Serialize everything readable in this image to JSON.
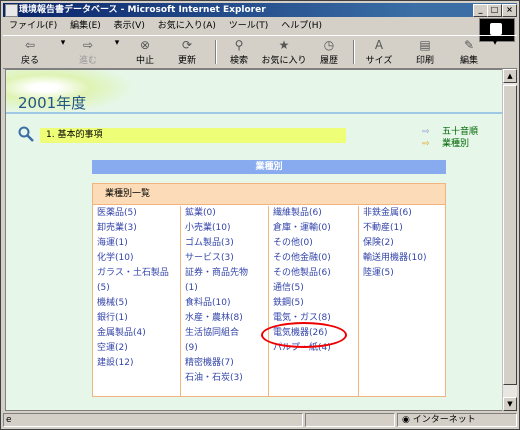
{
  "window": {
    "title": "環境報告書データベース - Microsoft Internet Explorer",
    "controls": [
      "_",
      "□",
      "×"
    ]
  },
  "menu": [
    "ファイル(F)",
    "編集(E)",
    "表示(V)",
    "お気に入り(A)",
    "ツール(T)",
    "ヘルプ(H)"
  ],
  "toolbar": {
    "back": "戻る",
    "forward": "進む",
    "stop": "中止",
    "refresh": "更新",
    "search": "検索",
    "favorites": "お気に入り",
    "history": "履歴",
    "size": "サイズ",
    "print": "印刷",
    "edit": "編集"
  },
  "page": {
    "year": "2001年度",
    "section": "1. 基本的事項",
    "links": [
      "五十音順",
      "業種別"
    ],
    "industry_header": "業種別",
    "industry_list_title": "業種別一覧",
    "columns": [
      [
        "医薬品(5)",
        "卸売業(3)",
        "海運(1)",
        "化学(10)",
        "ガラス・土石製品",
        "(5)",
        "機械(5)",
        "銀行(1)",
        "金属製品(4)",
        "空運(2)",
        "建設(12)"
      ],
      [
        "鉱業(0)",
        "小売業(10)",
        "ゴム製品(3)",
        "サービス(3)",
        "証券・商品先物",
        "(1)",
        "食料品(10)",
        "水産・農林(8)",
        "生活協同組合",
        "(9)",
        "精密機器(7)",
        "石油・石炭(3)"
      ],
      [
        "繊維製品(6)",
        "倉庫・運輸(0)",
        "その他(0)",
        "その他金融(0)",
        "その他製品(6)",
        "通信(5)",
        "鉄鋼(5)",
        "電気・ガス(8)",
        "電気機器(26)",
        "パルプ・紙(4)"
      ],
      [
        "非鉄金属(6)",
        "不動産(1)",
        "保険(2)",
        "輸送用機器(10)",
        "陸運(5)"
      ]
    ]
  },
  "status": {
    "zone": "インターネット"
  }
}
